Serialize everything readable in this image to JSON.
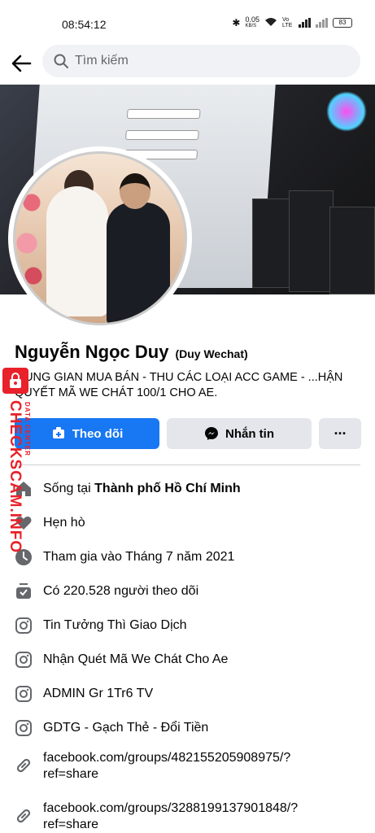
{
  "status_bar": {
    "time": "08:54:12",
    "net_speed": "0.05",
    "net_unit": "KB/S",
    "volte": "Vo LTE",
    "battery": "83"
  },
  "search": {
    "placeholder": "Tìm kiếm"
  },
  "profile": {
    "name": "Nguyễn Ngọc Duy",
    "alt_name": "(Duy Wechat)",
    "bio": "...UNG GIAN MUA BÁN - THU CÁC LOẠI ACC GAME - ...HẬN QUYẾT MÃ  WE CHÁT 100/1 CHO AE."
  },
  "actions": {
    "follow_label": "Theo dõi",
    "message_label": "Nhắn tin",
    "more_label": "···"
  },
  "details": [
    {
      "icon": "home-icon",
      "prefix": "Sống tại ",
      "bold": "Thành phố Hồ Chí Minh"
    },
    {
      "icon": "heart-icon",
      "prefix": "Hẹn hò",
      "bold": ""
    },
    {
      "icon": "clock-icon",
      "prefix": "Tham gia vào Tháng 7 năm 2021",
      "bold": ""
    },
    {
      "icon": "followers-icon",
      "prefix": "Có 220.528 người theo dõi",
      "bold": ""
    },
    {
      "icon": "instagram-icon",
      "prefix": "Tin Tưởng Thì Giao Dịch",
      "bold": ""
    },
    {
      "icon": "instagram-icon",
      "prefix": "Nhận Quét Mã We Chát Cho Ae",
      "bold": ""
    },
    {
      "icon": "instagram-icon",
      "prefix": "ADMIN Gr 1Tr6 TV",
      "bold": ""
    },
    {
      "icon": "instagram-icon",
      "prefix": "GDTG - Gạch Thẻ - Đổi Tiền",
      "bold": ""
    }
  ],
  "links": [
    {
      "icon": "link-icon",
      "line1": "facebook.com/groups/482155205908975/?",
      "line2": "ref=share"
    },
    {
      "icon": "link-icon",
      "line1": "facebook.com/groups/3288199137901848/?",
      "line2": "ref=share"
    }
  ],
  "watermark": {
    "text": "CHECKSCAM.INFO",
    "sub": "DATA CENTER"
  },
  "colors": {
    "accent": "#1877f2",
    "watermark": "#e8212a",
    "button_gray": "#e4e6eb",
    "icon_gray": "#65676b"
  }
}
